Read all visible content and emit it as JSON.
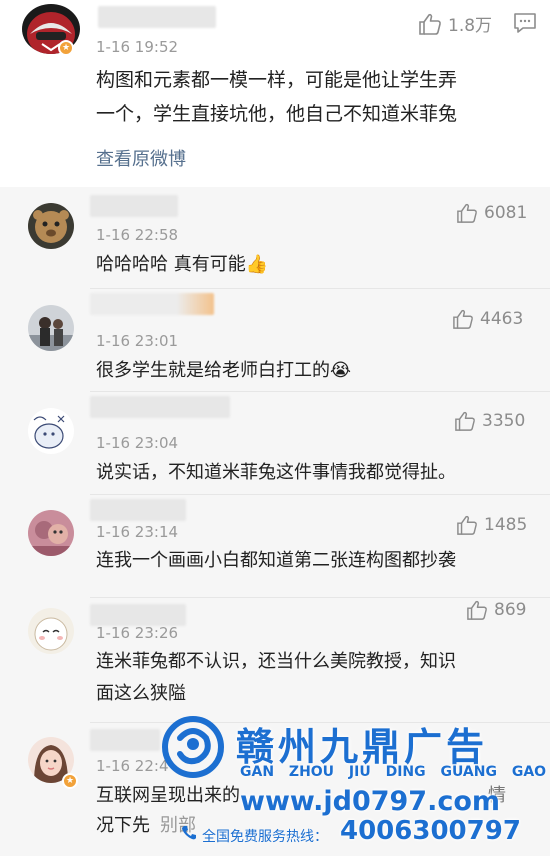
{
  "main_comment": {
    "time": "1-16 19:52",
    "text_line1": "构图和元素都一模一样，可能是他让学生弄",
    "text_line2": "一个，学生直接坑他，他自己不知道米菲兔",
    "likes": "1.8万",
    "view_original": "查看原微博",
    "icons": {
      "like": "thumbs-up-icon",
      "reply": "comment-icon",
      "badge": "verified-badge-icon"
    }
  },
  "replies": [
    {
      "time": "1-16 22:58",
      "text": "哈哈哈哈 真有可能👍",
      "likes": "6081"
    },
    {
      "time": "1-16 23:01",
      "text": "很多学生就是给老师白打工的😭",
      "likes": "4463"
    },
    {
      "time": "1-16 23:04",
      "text": "说实话，不知道米菲兔这件事情我都觉得扯。",
      "likes": "3350"
    },
    {
      "time": "1-16 23:14",
      "text": "连我一个画画小白都知道第二张连构图都抄袭",
      "likes": "1485"
    },
    {
      "time": "1-16 23:26",
      "text_line1": "连米菲兔都不认识，还当什么美院教授，知识",
      "text_line2": "面这么狭隘",
      "likes": "869"
    },
    {
      "time": "1-16 22:4",
      "text_line1": "互联网呈现出来的",
      "text_line2_left": "况下先",
      "text_line2_mid": "别部",
      "text_line1_right": "情"
    }
  ],
  "watermark": {
    "title": "赣州九鼎广告",
    "pinyin": "GAN ZHOU JIU DING GUANG GAO",
    "url": "www.jd0797.com",
    "hotline_label": "全国免费服务热线：",
    "hotline": "4006300797"
  },
  "colors": {
    "link": "#56708e",
    "muted": "#9a9a9a",
    "reply_bg": "#f6f6f6",
    "brand": "#1c6fd1"
  }
}
